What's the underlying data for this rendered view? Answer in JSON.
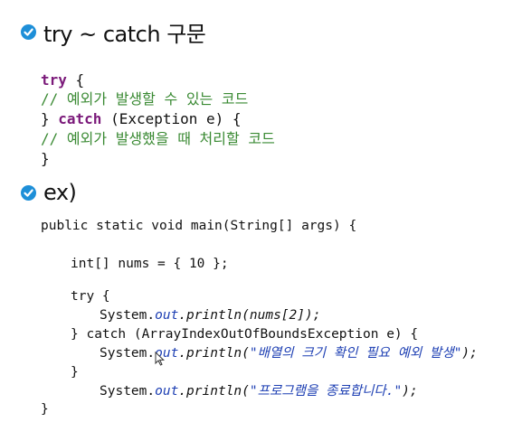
{
  "section1": {
    "title": "try ~ catch 구문",
    "code": {
      "try_kw": "try",
      "try_brace": " {",
      "comment1": "// 예외가 발생할 수 있는 코드",
      "catch_close": "} ",
      "catch_kw": "catch",
      "catch_params": " (Exception e) {",
      "comment2": "// 예외가 발생했을 때 처리할 코드",
      "end_brace": "}"
    }
  },
  "section2": {
    "title": "ex)",
    "code": {
      "line1": "public static void main(String[] args) {",
      "line2": "int[] nums = { 10 };",
      "line3": "try {",
      "line4_prefix": "System.",
      "line4_field": "out",
      "line4_method": ".println(nums[2]);",
      "line5": "} catch (ArrayIndexOutOfBoundsException e) {",
      "line6_prefix": "System.",
      "line6_field": "out",
      "line6_method": ".println(",
      "line6_string": "\"배열의 크기 확인 필요 예외 발생\"",
      "line6_suffix": ");",
      "line7": "}",
      "line8_prefix": "System.",
      "line8_field": "out",
      "line8_method": ".println(",
      "line8_string": "\"프로그램을 종료합니다.\"",
      "line8_suffix": ");",
      "line9": "}"
    }
  },
  "icons": {
    "bullet": "check-circle-icon",
    "cursor": "mouse-pointer-icon"
  },
  "colors": {
    "bullet": "#1e8fd8",
    "keyword": "#7b1a7a",
    "comment": "#3a8a33",
    "field": "#1d3fb3"
  }
}
